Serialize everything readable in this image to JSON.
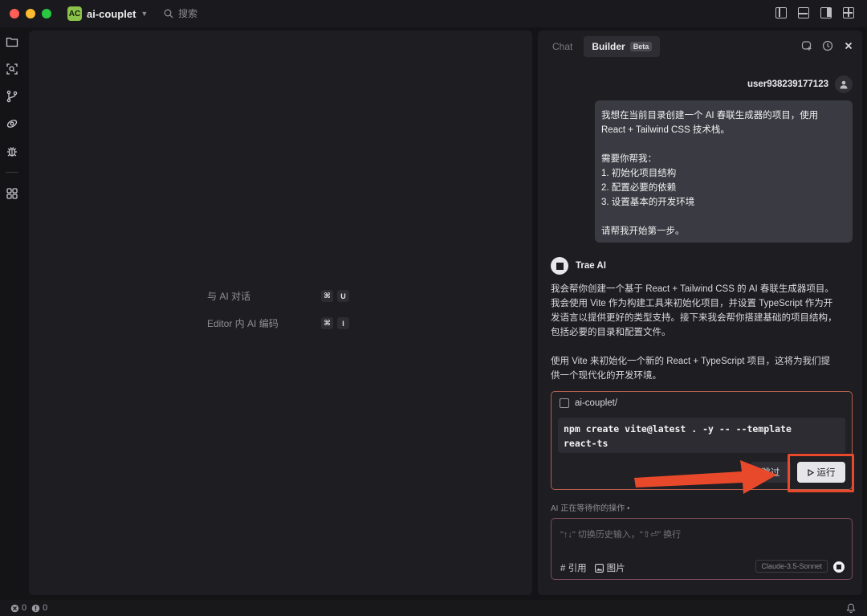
{
  "titlebar": {
    "traffic_colors": [
      "#ff5f57",
      "#febc2e",
      "#28c840"
    ],
    "project_badge": "AC",
    "project_name": "ai-couplet",
    "search_placeholder": "搜索"
  },
  "editor": {
    "hints": [
      {
        "label": "与 AI 对话",
        "keys": [
          "⌘",
          "U"
        ]
      },
      {
        "label": "Editor 内 AI 编码",
        "keys": [
          "⌘",
          "I"
        ]
      }
    ]
  },
  "chat": {
    "tabs": [
      {
        "label": "Chat"
      },
      {
        "label": "Builder",
        "badge": "Beta"
      }
    ],
    "user_name": "user938239177123",
    "user_message": [
      "我想在当前目录创建一个 AI 春联生成器的项目，使用",
      "React + Tailwind CSS 技术栈。",
      "",
      "需要你帮我：",
      "1. 初始化项目结构",
      "2. 配置必要的依赖",
      "3. 设置基本的开发环境",
      "",
      "请帮我开始第一步。"
    ],
    "ai_name": "Trae AI",
    "ai_paragraph_1": [
      "我会帮你创建一个基于 React + Tailwind CSS 的 AI 春联生成器项目。",
      "我会使用 Vite 作为构建工具来初始化项目，并设置 TypeScript 作为开",
      "发语言以提供更好的类型支持。接下来我会帮你搭建基础的项目结构，",
      "包括必要的目录和配置文件。"
    ],
    "ai_paragraph_2": [
      "使用 Vite 来初始化一个新的 React + TypeScript 项目，这将为我们提",
      "供一个现代化的开发环境。"
    ],
    "terminal": {
      "cwd": "ai-couplet/",
      "command_lines": [
        "npm create vite@latest . -y -- --template",
        "react-ts"
      ],
      "skip_label": "跳过",
      "run_label": "运行"
    },
    "waiting_text": "AI 正在等待你的操作 •",
    "input": {
      "placeholder": "\"↑↓\" 切换历史输入，\"⇧⏎\" 换行",
      "reference_label": "# 引用",
      "image_label": "图片",
      "model": "Claude-3.5-Sonnet"
    }
  },
  "status": {
    "errors": "0",
    "warnings": "0"
  },
  "colors": {
    "annotation": "#e8492b",
    "badge_green": "#8bc34a"
  }
}
